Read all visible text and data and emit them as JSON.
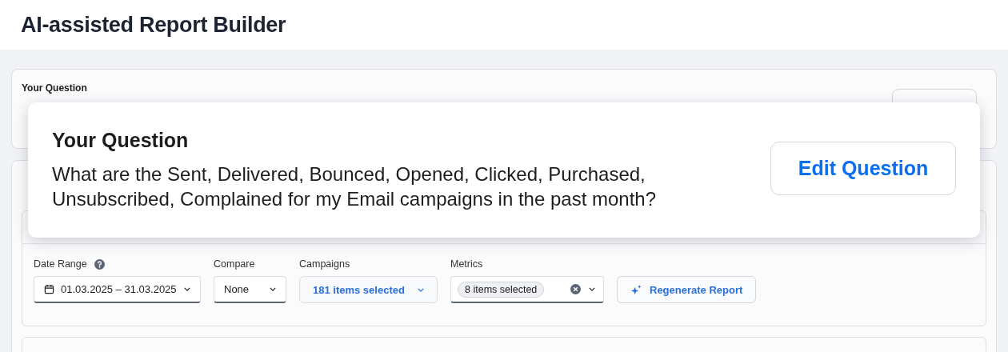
{
  "title": "AI-assisted Report Builder",
  "question_card": {
    "label": "Your Question"
  },
  "filters": [
    {
      "kind": "date",
      "label": "Date Range",
      "value": "01.03.2025 – 31.03.2025"
    },
    {
      "kind": "select",
      "label": "Compare",
      "value": "None"
    },
    {
      "kind": "multi",
      "label": "Campaigns",
      "value": "181 items selected"
    },
    {
      "kind": "token",
      "label": "Metrics",
      "value": "8 items selected"
    }
  ],
  "regenerate_button": "Regenerate Report",
  "popover": {
    "title": "Your Question",
    "text": "What are the Sent, Delivered, Bounced, Opened, Clicked, Purchased, Unsubscribed, Complained for my Email campaigns in the past month?",
    "button": "Edit Question"
  }
}
